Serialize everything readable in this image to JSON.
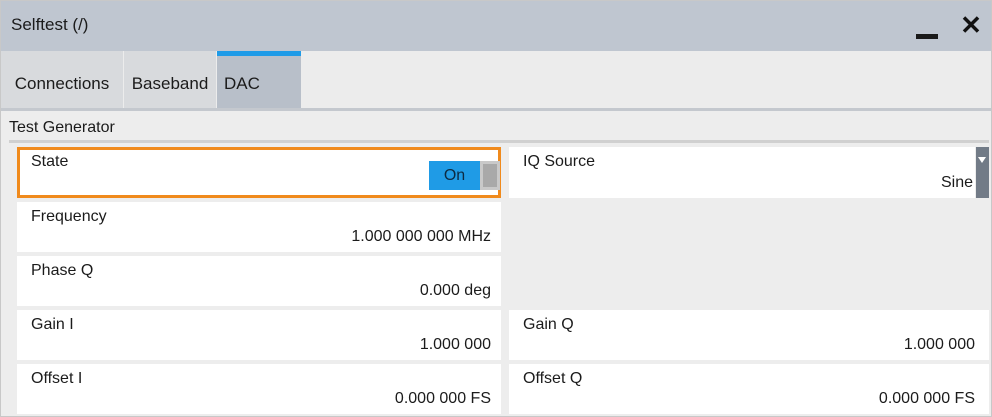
{
  "window": {
    "title": "Selftest (/)"
  },
  "tabs": [
    {
      "label": "Connections",
      "active": false
    },
    {
      "label": "Baseband",
      "active": false
    },
    {
      "label": "DAC",
      "active": true
    }
  ],
  "section": {
    "title": "Test Generator"
  },
  "fields": {
    "state": {
      "label": "State",
      "value": "On"
    },
    "iq_source": {
      "label": "IQ Source",
      "value": "Sine"
    },
    "frequency": {
      "label": "Frequency",
      "value": "1.000 000 000 MHz"
    },
    "phase_q": {
      "label": "Phase Q",
      "value": "0.000 deg"
    },
    "gain_i": {
      "label": "Gain I",
      "value": "1.000 000"
    },
    "gain_q": {
      "label": "Gain Q",
      "value": "1.000 000"
    },
    "offset_i": {
      "label": "Offset I",
      "value": "0.000 000 FS"
    },
    "offset_q": {
      "label": "Offset Q",
      "value": "0.000 000 FS"
    }
  },
  "icons": {
    "minimize": "minimize-icon",
    "close": "close-icon",
    "dropdown": "chevron-down-icon"
  },
  "colors": {
    "accent": "#1e9be8",
    "focus_outline": "#f08a1c",
    "titlebar": "#bfc6d0"
  }
}
